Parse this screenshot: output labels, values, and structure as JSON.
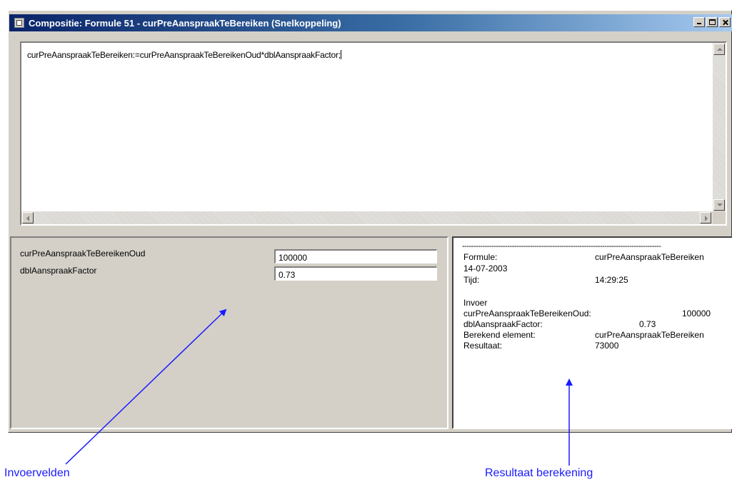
{
  "window": {
    "title": "Compositie: Formule 51 - curPreAanspraakTeBereiken (Snelkoppeling)",
    "buttons": [
      "minimize-icon",
      "maximize-icon",
      "close-icon"
    ]
  },
  "editor": {
    "formula": "curPreAanspraakTeBereiken:=curPreAanspraakTeBereikenOud*dblAanspraakFactor;"
  },
  "inputs": [
    {
      "label": "curPreAanspraakTeBereikenOud",
      "value": "100000"
    },
    {
      "label": "dblAanspraakFactor",
      "value": "0.73"
    }
  ],
  "result": {
    "separator": "----------------------------------------------------------------------------------------",
    "formule_label": "Formule:",
    "formule_value": "curPreAanspraakTeBereiken",
    "date": "14-07-2003",
    "tijd_label": "Tijd:",
    "tijd_value": "14:29:25",
    "invoer_heading": "Invoer",
    "invoer_rows": [
      {
        "label": "curPreAanspraakTeBereikenOud:",
        "value": "100000"
      },
      {
        "label": "dblAanspraakFactor:",
        "value": "0.73"
      }
    ],
    "berekend_label": "Berekend element:",
    "berekend_value": "curPreAanspraakTeBereiken",
    "resultaat_label": "Resultaat:",
    "resultaat_value": "73000"
  },
  "annotations": {
    "invoervelden": "Invoervelden",
    "resultaat": "Resultaat berekening",
    "color": "#1a1aff"
  }
}
